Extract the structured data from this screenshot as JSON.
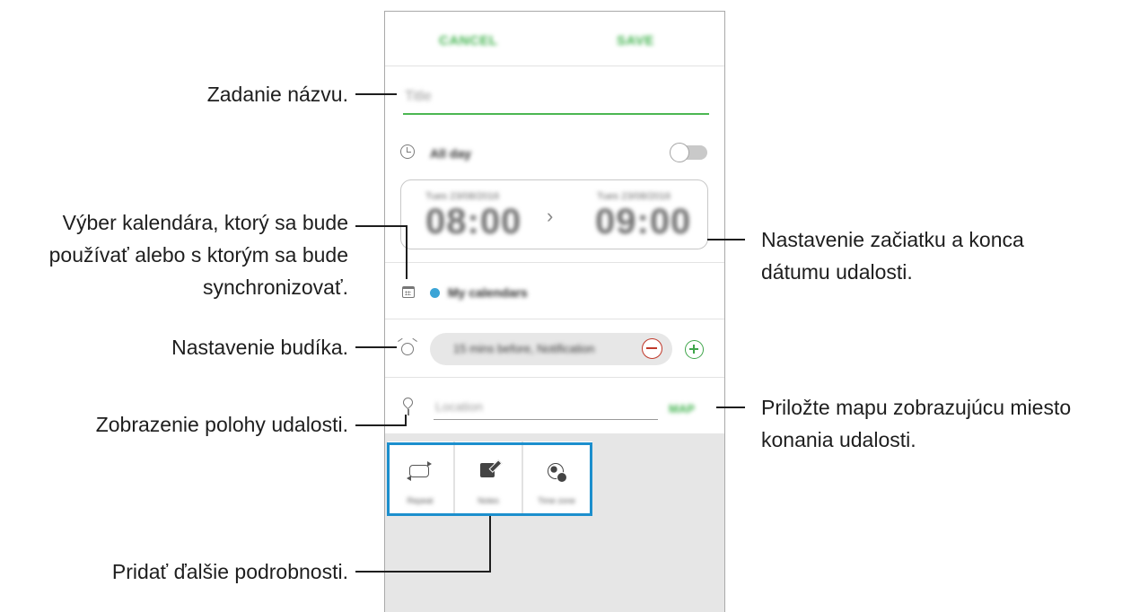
{
  "phone": {
    "top_bar": {
      "cancel_label": "CANCEL",
      "save_label": "SAVE"
    },
    "title_field": {
      "placeholder": "Title"
    },
    "all_day": {
      "label": "All day",
      "toggle_on": false
    },
    "time_range": {
      "start_caption": "Tues 23/08/2016",
      "start_time": "08:00",
      "end_caption": "Tues 23/08/2016",
      "end_time": "09:00",
      "arrow": "›"
    },
    "calendar": {
      "name": "My calendars",
      "dot_color": "#3ba4d6"
    },
    "reminder": {
      "text": "15 mins before, Notification"
    },
    "location": {
      "placeholder": "Location",
      "map_label": "MAP"
    },
    "extras": [
      {
        "label": "Repeat",
        "icon": "repeat-icon"
      },
      {
        "label": "Notes",
        "icon": "note-icon"
      },
      {
        "label": "Time zone",
        "icon": "globe-icon"
      }
    ],
    "accent_color": "#3fb24c"
  },
  "callouts": {
    "title": "Zadanie názvu.",
    "calendar_line1": "Výber kalendára, ktorý sa bude",
    "calendar_line2": "používať alebo s ktorým sa bude",
    "calendar_line3": "synchronizovať.",
    "alarm": "Nastavenie budíka.",
    "location": "Zobrazenie polohy udalosti.",
    "details": "Pridať ďalšie podrobnosti.",
    "dates_line1": "Nastavenie začiatku a konca",
    "dates_line2": "dátumu udalosti.",
    "map_line1": "Priložte mapu zobrazujúcu miesto",
    "map_line2": "konania udalosti."
  }
}
